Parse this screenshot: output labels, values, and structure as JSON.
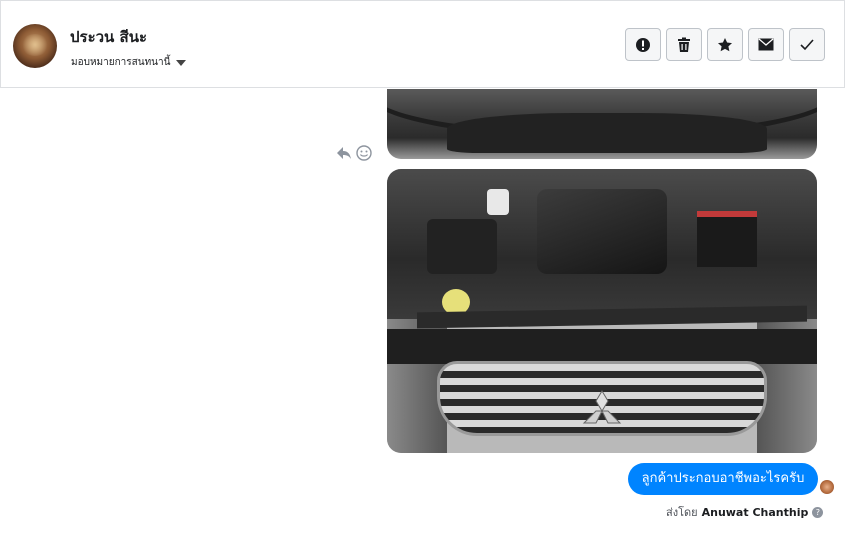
{
  "header": {
    "contact_name": "ประวน สีนะ",
    "assign_label": "มอบหมายการสนทนานี้"
  },
  "actions": [
    {
      "icon": "alert-icon",
      "label": "Mark as spam"
    },
    {
      "icon": "trash-icon",
      "label": "Delete"
    },
    {
      "icon": "star-icon",
      "label": "Star"
    },
    {
      "icon": "envelope-icon",
      "label": "Mark as unread"
    },
    {
      "icon": "check-icon",
      "label": "Mark as done"
    }
  ],
  "thread": {
    "reaction_icons": [
      "reply-icon",
      "smiley-icon"
    ],
    "message_text": "ลูกค้าประกอบอาชีพอะไรครับ",
    "sent_by_prefix": "ส่งโดย",
    "sent_by_name": "Anuwat Chanthip"
  },
  "colors": {
    "bubble": "#0084ff",
    "border": "#dddfe2"
  }
}
